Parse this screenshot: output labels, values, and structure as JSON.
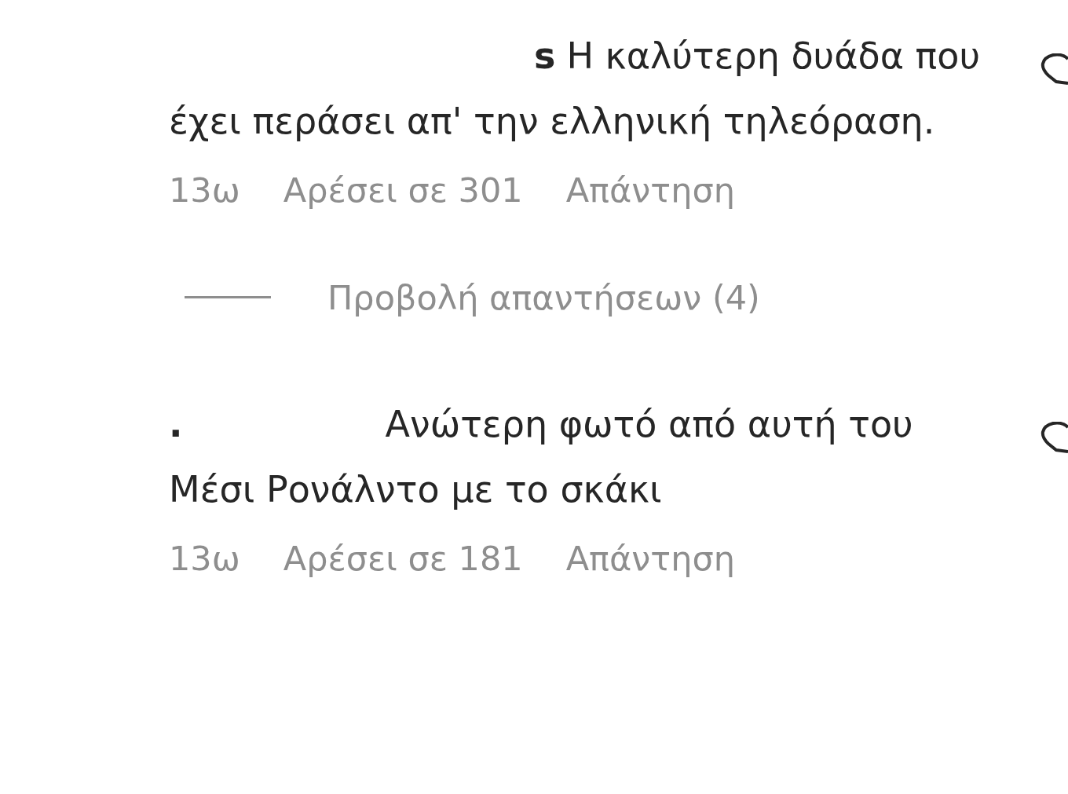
{
  "comments": [
    {
      "username": "s",
      "text": "Η καλύτερη δυάδα που έχει περάσει απ' την ελληνική τηλεόραση.",
      "time": "13ω",
      "likes": "Αρέσει σε 301",
      "reply": "Απάντηση",
      "view_replies": "Προβολή απαντήσεων (4)"
    },
    {
      "username": ".",
      "text": "Ανώτερη φωτό από αυτή του Μέσι Ρονάλντο με το σκάκι",
      "time": "13ω",
      "likes": "Αρέσει σε 181",
      "reply": "Απάντηση"
    }
  ]
}
